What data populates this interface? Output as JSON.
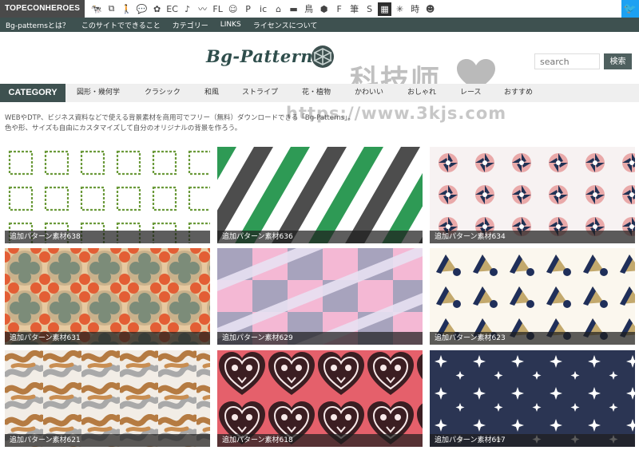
{
  "topbar": {
    "brand": "TOPECONHEROES",
    "icons": [
      {
        "name": "cow-icon",
        "glyph": "🐄"
      },
      {
        "name": "copy-icon",
        "glyph": "⧉"
      },
      {
        "name": "person-icon",
        "glyph": "🚶"
      },
      {
        "name": "chat-icon",
        "glyph": "💬"
      },
      {
        "name": "flower-icon",
        "glyph": "✿"
      },
      {
        "name": "ec-icon",
        "glyph": "EC"
      },
      {
        "name": "music-note-icon",
        "glyph": "♪"
      },
      {
        "name": "line-icon",
        "glyph": "〰"
      },
      {
        "name": "flat-icon",
        "glyph": "FL"
      },
      {
        "name": "smile-icon",
        "glyph": "☺"
      },
      {
        "name": "p-icon",
        "glyph": "P"
      },
      {
        "name": "icon-text-icon",
        "glyph": "ic"
      },
      {
        "name": "house-icon",
        "glyph": "⌂"
      },
      {
        "name": "bed-icon",
        "glyph": "▬"
      },
      {
        "name": "cat-icon",
        "glyph": "鳥"
      },
      {
        "name": "hexagon-icon",
        "glyph": "⬢"
      },
      {
        "name": "font-f-icon",
        "glyph": "F"
      },
      {
        "name": "brush-icon",
        "glyph": "筆"
      },
      {
        "name": "s-icon",
        "glyph": "S"
      },
      {
        "name": "grid-icon",
        "glyph": "▦"
      },
      {
        "name": "pattern-icon",
        "glyph": "✳"
      },
      {
        "name": "clock-kanji-icon",
        "glyph": "時"
      },
      {
        "name": "mask-icon",
        "glyph": "☻"
      }
    ],
    "twitter_glyph": "🐦"
  },
  "nav": {
    "items": [
      "Bg-patternsとは？",
      "このサイトでできること",
      "カテゴリー",
      "LINKS",
      "ライセンスについて"
    ]
  },
  "header": {
    "logo_text": "Bg-Patterns",
    "search_placeholder": "search",
    "search_button": "検索"
  },
  "watermark": {
    "cn": "科技师",
    "url": "https://www.3kjs.com"
  },
  "categories": {
    "label": "CATEGORY",
    "items": [
      "図形・幾何学",
      "クラシック",
      "和風",
      "ストライプ",
      "花・植物",
      "かわいい",
      "おしゃれ",
      "レース",
      "おすすめ"
    ]
  },
  "intro": {
    "line1": "WEBやDTP、ビジネス資料などで使える背景素材を商用可でフリー（無料）ダウンロードできる「Bg-Patterns」。",
    "line2": "色や形、サイズも自由にカスタマイズして自分のオリジナルの背景を作ろう。"
  },
  "tiles": [
    {
      "caption": "追加パターン素材638"
    },
    {
      "caption": "追加パターン素材636"
    },
    {
      "caption": "追加パターン素材634"
    },
    {
      "caption": "追加パターン素材631"
    },
    {
      "caption": "追加パターン素材629"
    },
    {
      "caption": "追加パターン素材623"
    },
    {
      "caption": "追加パターン素材621"
    },
    {
      "caption": "追加パターン素材618"
    },
    {
      "caption": "追加パターン素材617"
    }
  ],
  "colors": {
    "nav_bg": "#3e5150",
    "accent": "#2f4e4c",
    "twitter": "#1da1f2"
  }
}
